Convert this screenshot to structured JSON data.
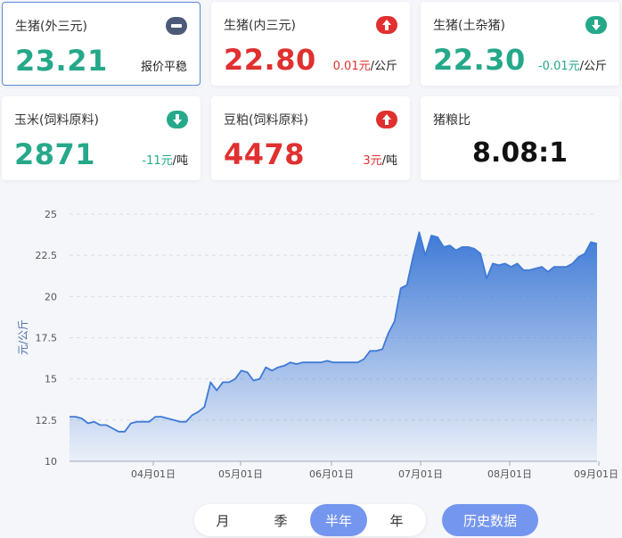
{
  "colors": {
    "up": "#e03030",
    "down": "#26a88a",
    "flat": "#4a5a78",
    "accent": "#7596ee"
  },
  "cards": [
    {
      "title": "生猪(外三元)",
      "value": "23.21",
      "change": "",
      "unit": "报价平稳",
      "trend": "flat",
      "icon": "minus-icon"
    },
    {
      "title": "生猪(内三元)",
      "value": "22.80",
      "change": "0.01元",
      "unit": "/公斤",
      "trend": "up",
      "icon": "arrow-up-icon"
    },
    {
      "title": "生猪(土杂猪)",
      "value": "22.30",
      "change": "-0.01元",
      "unit": "/公斤",
      "trend": "down",
      "icon": "arrow-down-icon"
    },
    {
      "title": "玉米(饲料原料)",
      "value": "2871",
      "change": "-11元",
      "unit": "/吨",
      "trend": "down",
      "icon": "arrow-down-icon"
    },
    {
      "title": "豆粕(饲料原料)",
      "value": "4478",
      "change": "3元",
      "unit": "/吨",
      "trend": "up",
      "icon": "arrow-up-icon"
    },
    {
      "title": "猪粮比",
      "value": "8.08:1"
    }
  ],
  "chart_data": {
    "type": "area",
    "ylabel": "元/公斤",
    "ylim": [
      10,
      25
    ],
    "yticks": [
      "10",
      "12.5",
      "15",
      "17.5",
      "20",
      "22.5",
      "25"
    ],
    "xticks": [
      "04月01日",
      "05月01日",
      "06月01日",
      "07月01日",
      "08月01日",
      "09月01日"
    ],
    "grid": true,
    "series": [
      {
        "values": [
          12.7,
          12.7,
          12.6,
          12.3,
          12.4,
          12.2,
          12.2,
          12.0,
          11.8,
          11.8,
          12.3,
          12.4,
          12.4,
          12.4,
          12.7,
          12.7,
          12.6,
          12.5,
          12.4,
          12.4,
          12.8,
          13.0,
          13.3,
          14.8,
          14.3,
          14.8,
          14.8,
          15.0,
          15.5,
          15.4,
          14.9,
          15.0,
          15.7,
          15.5,
          15.7,
          15.8,
          16.0,
          15.9,
          16.0,
          16.0,
          16.0,
          16.0,
          16.1,
          16.0,
          16.0,
          16.0,
          16.0,
          16.0,
          16.2,
          16.7,
          16.7,
          16.8,
          17.8,
          18.5,
          20.5,
          20.7,
          22.4,
          23.9,
          22.5,
          23.7,
          23.6,
          23.0,
          23.1,
          22.8,
          23.0,
          23.0,
          22.9,
          22.6,
          21.1,
          22.0,
          21.9,
          22.0,
          21.8,
          22.0,
          21.6,
          21.6,
          21.7,
          21.8,
          21.5,
          21.8,
          21.8,
          21.8,
          22.0,
          22.4,
          22.6,
          23.3,
          23.2
        ]
      }
    ]
  },
  "controls": {
    "periods": [
      "月",
      "季",
      "半年",
      "年"
    ],
    "active_period": "半年",
    "history_label": "历史数据"
  }
}
